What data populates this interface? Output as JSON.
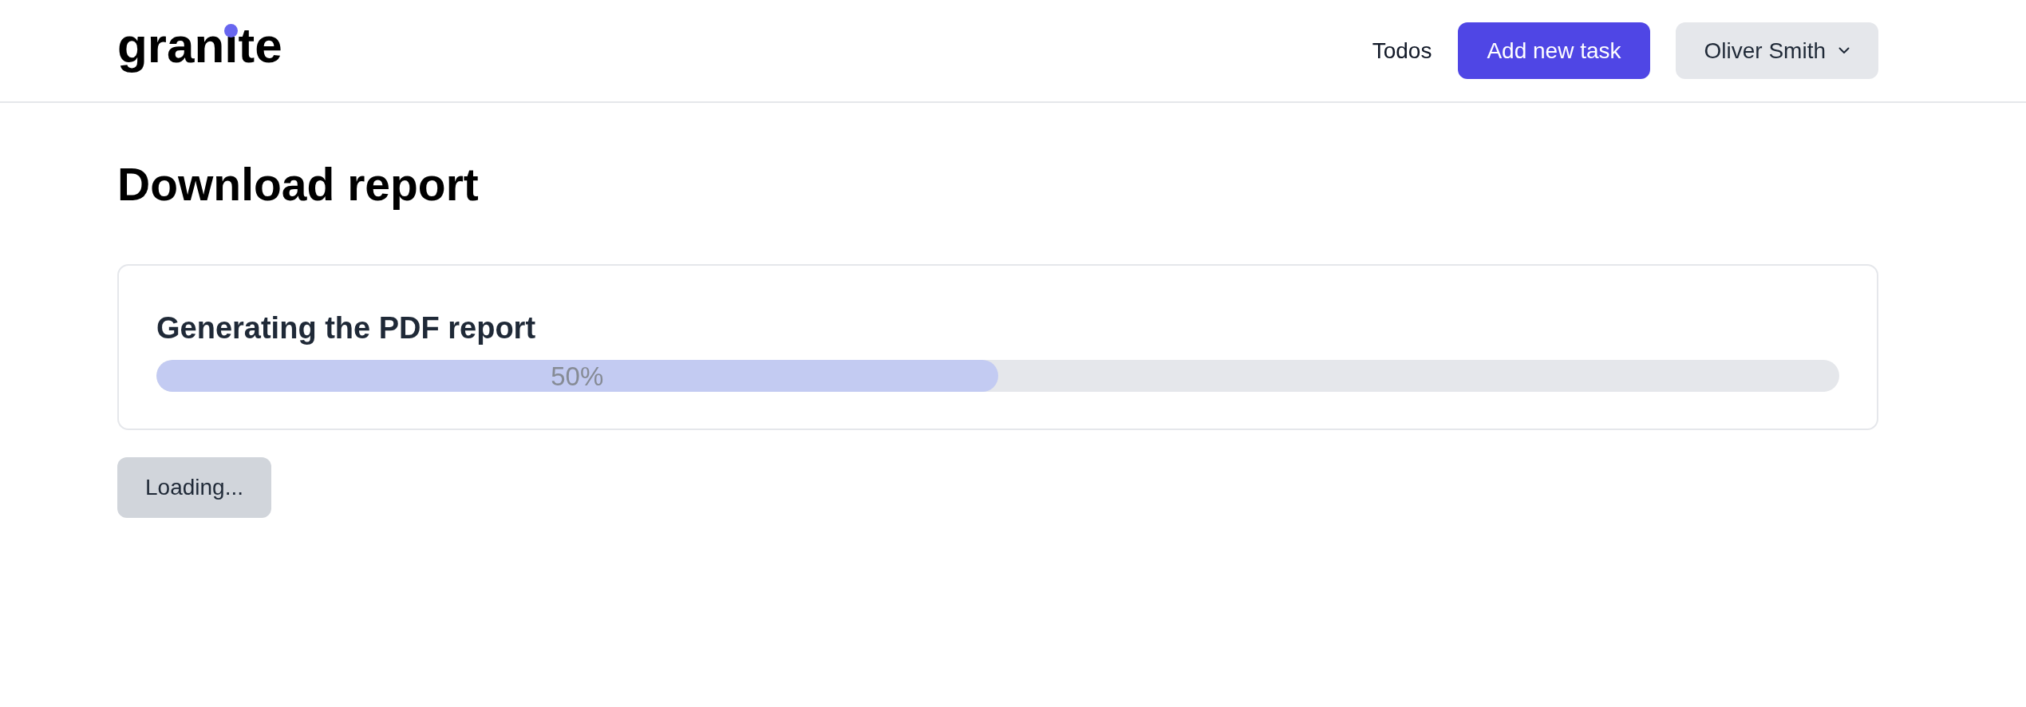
{
  "header": {
    "logo": {
      "text": "granite"
    },
    "nav_link": "Todos",
    "add_button": "Add new task",
    "user_menu": {
      "label": "Oliver Smith"
    }
  },
  "page": {
    "title": "Download report"
  },
  "report_card": {
    "heading": "Generating the PDF report",
    "progress": {
      "level": 0.5,
      "label": "50%"
    }
  },
  "status_button": {
    "label": "Loading...",
    "disabled": true
  }
}
